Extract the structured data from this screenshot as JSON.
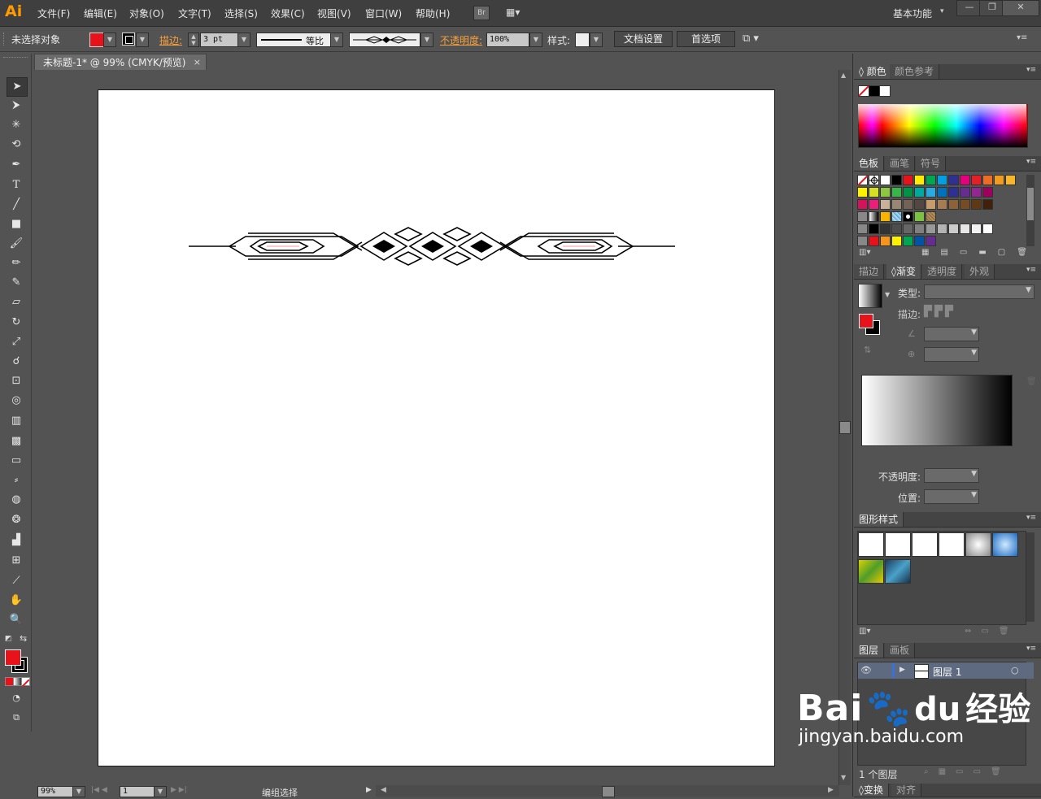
{
  "app": {
    "logo": "Ai",
    "workspace": "基本功能"
  },
  "menu": [
    "文件(F)",
    "编辑(E)",
    "对象(O)",
    "文字(T)",
    "选择(S)",
    "效果(C)",
    "视图(V)",
    "窗口(W)",
    "帮助(H)"
  ],
  "menu_extra": {
    "br_label": "Br"
  },
  "control": {
    "selection": "未选择对象",
    "fill_color": "#e8121a",
    "stroke_label": "描边:",
    "stroke_weight": "3 pt",
    "profile_label": "等比",
    "opacity_label": "不透明度:",
    "opacity_value": "100%",
    "style_label": "样式:",
    "doc_setup": "文档设置",
    "prefs": "首选项"
  },
  "document": {
    "tab_title": "未标题-1* @ 99% (CMYK/预览)",
    "close": "×"
  },
  "status": {
    "zoom": "99%",
    "artboard_num": "1",
    "mode": "编组选择"
  },
  "color_panel": {
    "tabs": [
      "颜色",
      "颜色参考"
    ]
  },
  "swatches_panel": {
    "tabs": [
      "色板",
      "画笔",
      "符号"
    ],
    "row1": [
      "#ffffff",
      "#000000",
      "#e8121a",
      "#ffec00",
      "#00a650",
      "#00a0e3",
      "#2e3192",
      "#e5007e",
      "#e61e25",
      "#ec6d23",
      "#f29c1f",
      "#f8b62b"
    ],
    "row2": [
      "#fff100",
      "#d7df23",
      "#8dc63f",
      "#39b54a",
      "#009245",
      "#00a99d",
      "#29abe2",
      "#0071bc",
      "#2e3192",
      "#662d91",
      "#92278f",
      "#9e005d"
    ],
    "row3": [
      "#d4145a",
      "#ed1e79",
      "#c7b299",
      "#998675",
      "#736357",
      "#534741",
      "#c69c6d",
      "#a67c52",
      "#8c6239",
      "#754c24",
      "#603813",
      "#42210b"
    ],
    "row5": [
      "#000000",
      "#333333",
      "#4d4d4d",
      "#666666",
      "#808080",
      "#999999",
      "#b3b3b3",
      "#cccccc",
      "#e6e6e6",
      "#f2f2f2",
      "#ffffff"
    ],
    "row6": [
      "#e8121a",
      "#f7941d",
      "#fff200",
      "#00a651",
      "#0054a6",
      "#662d91"
    ]
  },
  "gradient_panel": {
    "tabs": [
      "描边",
      "渐变",
      "透明度",
      "外观"
    ],
    "type_label": "类型:",
    "stroke_label": "描边:",
    "opacity_label": "不透明度:",
    "position_label": "位置:"
  },
  "graphic_styles": {
    "title": "图形样式"
  },
  "layers_panel": {
    "tabs": [
      "图层",
      "画板"
    ],
    "layer_name": "图层 1",
    "count": "1 个图层"
  },
  "bottom_tabs": [
    "变换",
    "对齐"
  ],
  "watermark": {
    "brand": "Bai",
    "paw": "du",
    "product": "经验",
    "url": "jingyan.baidu.com"
  }
}
